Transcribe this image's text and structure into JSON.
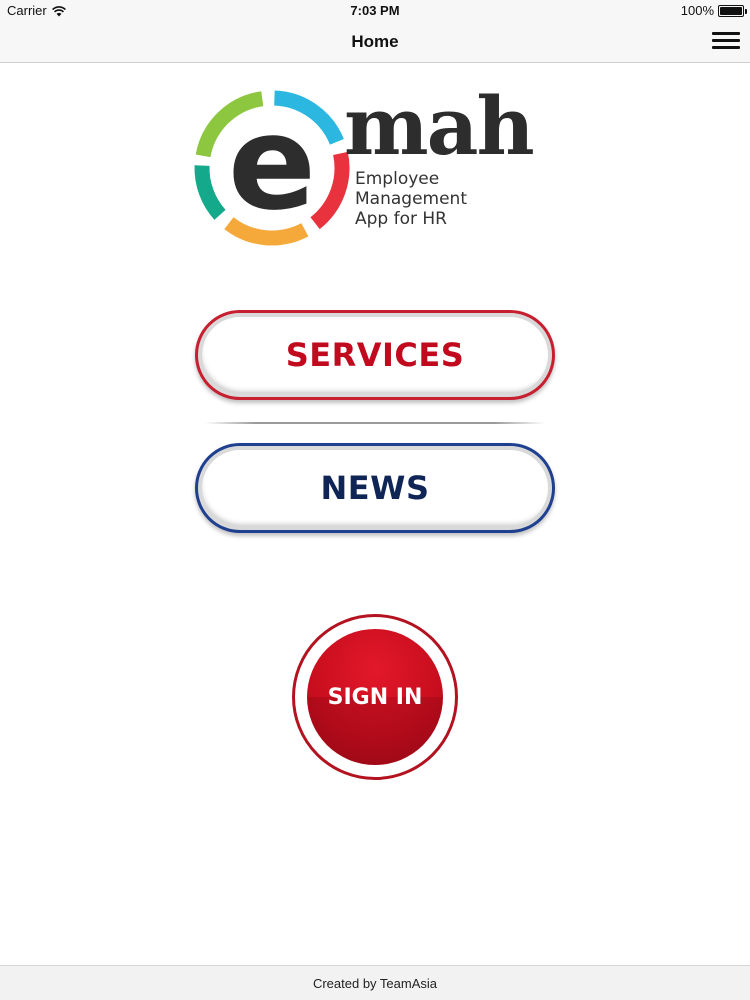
{
  "status_bar": {
    "carrier": "Carrier",
    "time": "7:03 PM",
    "battery_percent": "100%",
    "battery_level": 1.0
  },
  "nav_bar": {
    "title": "Home",
    "menu_icon": "hamburger-menu-icon"
  },
  "logo": {
    "wordmark": "mah",
    "mark_letter": "e",
    "tagline": [
      "Employee",
      "Management",
      "App for HR"
    ],
    "ring_colors": [
      "#8dc63f",
      "#2bb7e0",
      "#e8323e",
      "#f6a93b",
      "#14a98b"
    ]
  },
  "buttons": {
    "services": "SERVICES",
    "news": "NEWS",
    "sign_in": "SIGN IN"
  },
  "colors": {
    "services_red": "#c20a1e",
    "news_navy": "#0f2556",
    "sign_in_red": "#c80e1e"
  },
  "footer": {
    "text": "Created by TeamAsia"
  }
}
